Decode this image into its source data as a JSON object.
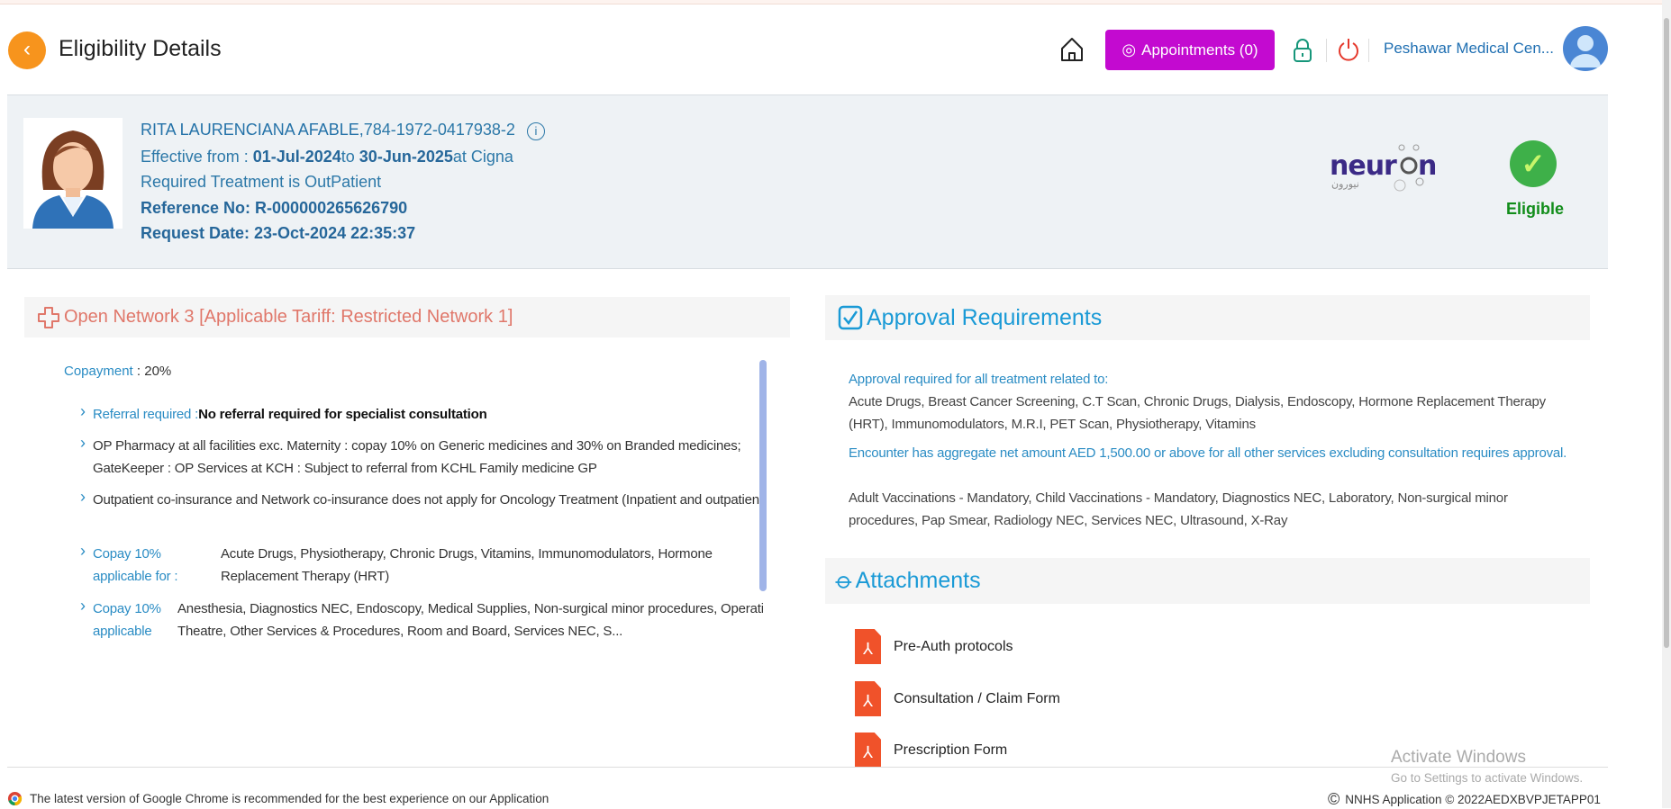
{
  "header": {
    "title": "Eligibility Details",
    "appointments_label": "Appointments (0)",
    "facility": "Peshawar Medical Cen..."
  },
  "patient": {
    "name": "RITA LAURENCIANA AFABLE,",
    "id": "784-1972-0417938-2",
    "effective_prefix": "Effective from : ",
    "from": "01-Jul-2024",
    "to_word": "to ",
    "to": "30-Jun-2025",
    "at": "at Cigna",
    "treatment": "Required Treatment is OutPatient",
    "reference": "Reference No: R-000000265626790",
    "request_date": "Request Date: 23-Oct-2024 22:35:37",
    "payer_logo": "neuron",
    "status": "Eligible"
  },
  "network": {
    "title": "Open Network 3 [Applicable Tariff: Restricted Network 1]",
    "copay_label": "Copayment",
    "copay_value": ": 20%",
    "referral_label": "Referral required :",
    "referral_value": "No referral required for specialist consultation",
    "item2": "OP Pharmacy at all facilities exc. Maternity : copay 10% on Generic medicines and 30% on Branded medicines; GateKeeper : OP Services at KCH : Subject to referral from KCHL Family medicine GP",
    "item3": "Outpatient co-insurance and Network co-insurance does not apply for Oncology Treatment (Inpatient and outpatient)",
    "copay1_label": "Copay 10% applicable for :",
    "copay1_value": "Acute Drugs, Physiotherapy, Chronic Drugs, Vitamins, Immunomodulators, Hormone Replacement Therapy (HRT)",
    "copay2_label": "Copay 10% applicable for :",
    "copay2_value": "Anesthesia, Diagnostics NEC, Endoscopy, Medical Supplies, Non-surgical minor procedures, Operating Theatre, Other Services & Procedures, Room and Board, Services NEC, S..."
  },
  "approval": {
    "title": "Approval Requirements",
    "h1": "Approval required for all treatment related to:",
    "t1": "Acute Drugs, Breast Cancer Screening, C.T Scan, Chronic Drugs, Dialysis, Endoscopy, Hormone Replacement Therapy (HRT), Immunomodulators, M.R.I, PET Scan, Physiotherapy, Vitamins",
    "h2": "Encounter has aggregate net amount AED 1,500.00 or above for all other services excluding consultation requires approval.",
    "t2": "Adult Vaccinations - Mandatory, Child Vaccinations - Mandatory, Diagnostics NEC, Laboratory, Non-surgical minor procedures, Pap Smear, Radiology NEC, Services NEC, Ultrasound, X-Ray"
  },
  "attachments": {
    "title": "Attachments",
    "items": [
      "Pre-Auth protocols",
      "Consultation / Claim Form",
      "Prescription Form"
    ]
  },
  "footer": {
    "left": "The latest version of Google Chrome is recommended for the best experience on our Application",
    "right": "NNHS Application © 2022AEDXBVPJETAPP01"
  },
  "watermark": {
    "line1": "Activate Windows",
    "line2": "Go to Settings to activate Windows."
  }
}
